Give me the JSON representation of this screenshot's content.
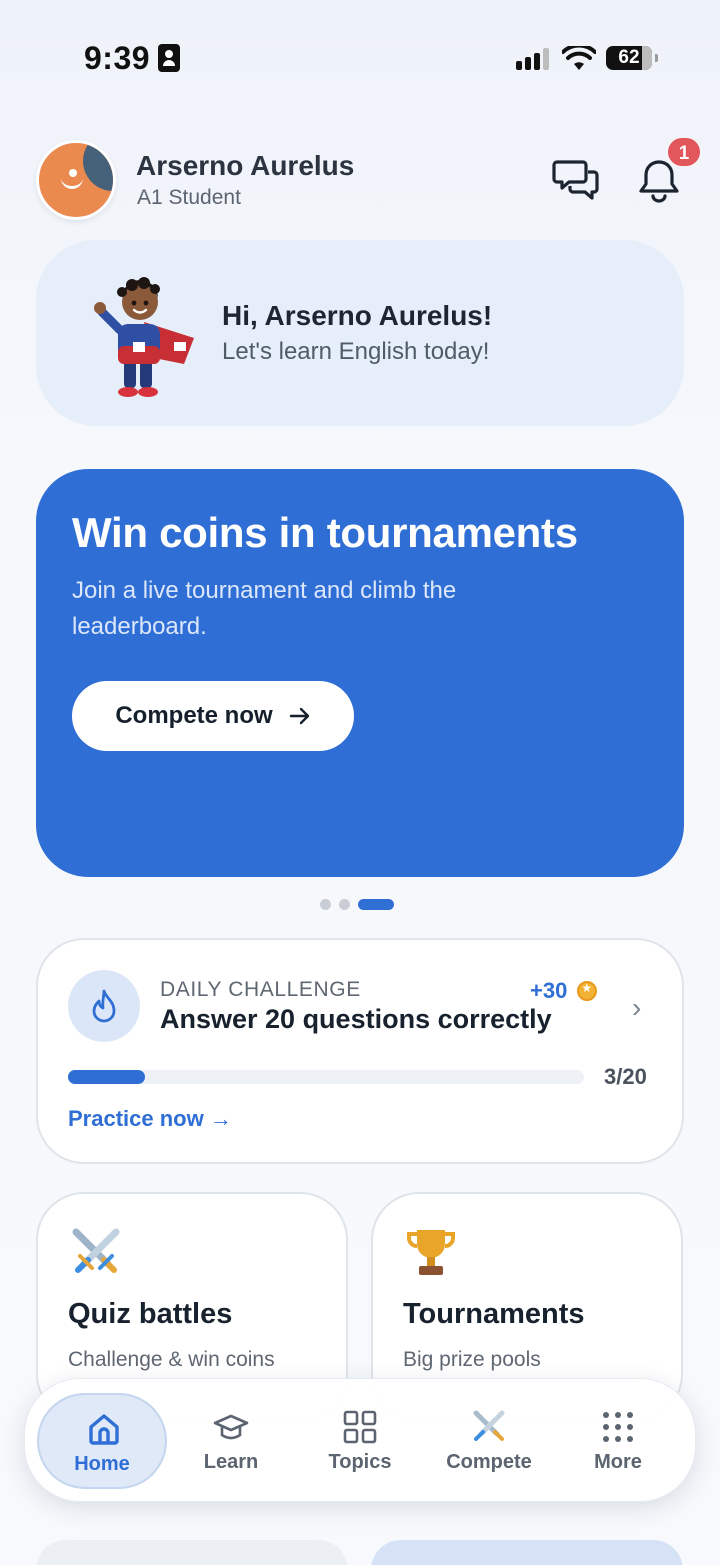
{
  "status_bar": {
    "time": "9:39",
    "battery": "62"
  },
  "header": {
    "user_name": "Arserno Aurelus",
    "user_level": "A1 Student",
    "notification_count": "1"
  },
  "greeting": {
    "title": "Hi, Arserno Aurelus!",
    "subtitle": "Let's learn English today!"
  },
  "promo": {
    "title": "Win coins in tournaments",
    "subtitle": "Join a live tournament and climb the leaderboard.",
    "button_label": "Compete now",
    "button_icon": "arrow-right-icon",
    "page_count": 3,
    "active_page": 3
  },
  "daily_challenge": {
    "label": "DAILY CHALLENGE",
    "title": "Answer 20 questions correctly",
    "reward": "+30",
    "progress_text": "3/20",
    "progress_fraction": 0.15,
    "link_label": "Practice now →"
  },
  "features": [
    {
      "title": "Quiz battles",
      "subtitle": "Challenge & win coins",
      "icon": "crossed-swords-icon"
    },
    {
      "title": "Tournaments",
      "subtitle": "Big prize pools",
      "icon": "trophy-icon"
    }
  ],
  "tabs": [
    {
      "label": "Home",
      "icon": "home-icon",
      "active": true
    },
    {
      "label": "Learn",
      "icon": "graduation-cap-icon",
      "active": false
    },
    {
      "label": "Topics",
      "icon": "grid-icon",
      "active": false
    },
    {
      "label": "Compete",
      "icon": "crossed-swords-icon",
      "active": false
    },
    {
      "label": "More",
      "icon": "dots-grid-icon",
      "active": false
    }
  ],
  "colors": {
    "primary": "#2f6ed4",
    "badge": "#e2575c",
    "card_bg": "#e6eef9"
  }
}
